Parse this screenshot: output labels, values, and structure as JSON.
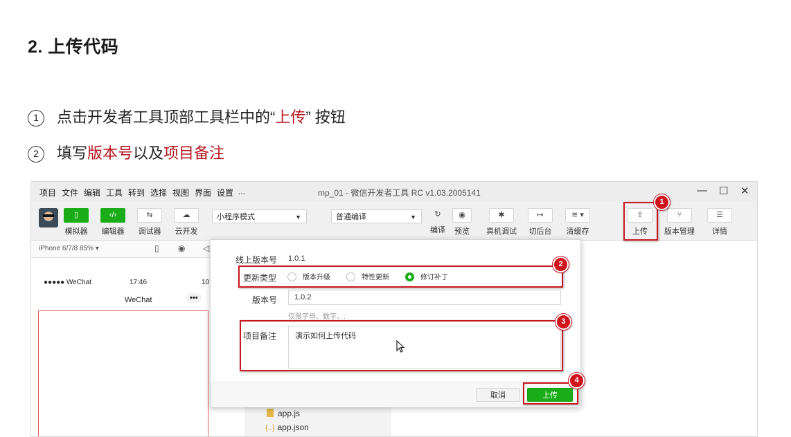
{
  "doc": {
    "heading": "2. 上传代码",
    "steps": [
      {
        "num": "1",
        "pre": "点击开发者工具顶部工具栏中的“",
        "hl": "上传",
        "post": "” 按钮"
      },
      {
        "num": "2",
        "pre": "填写",
        "hl1": "版本号",
        "mid": "以及",
        "hl2": "项目备注"
      }
    ]
  },
  "window": {
    "menu": [
      "项目",
      "文件",
      "编辑",
      "工具",
      "转到",
      "选择",
      "视图",
      "界面",
      "设置",
      "..."
    ],
    "title": "mp_01 - 微信开发者工具 RC v1.03.2005141",
    "controls": {
      "min": "—",
      "max": "☐",
      "close": "✕"
    }
  },
  "toolbar": {
    "simulator": "模拟器",
    "editor": "编辑器",
    "debugger": "调试器",
    "cloud": "云开发",
    "mode_select": "小程序模式",
    "compile_select": "普通编译",
    "compile": "编译",
    "preview": "预览",
    "remote_debug": "真机调试",
    "background": "切后台",
    "clear_cache": "清缓存",
    "upload": "上传",
    "version_mgmt": "版本管理",
    "details": "详情",
    "icons": {
      "simulator": "phone-icon",
      "editor": "code-icon",
      "debugger": "arrows-icon",
      "cloud": "cloud-icon",
      "compile": "refresh-icon",
      "preview": "eye-icon",
      "remote_debug": "bug-icon",
      "background": "switch-icon",
      "clear_cache": "layers-icon",
      "upload": "upload-icon",
      "version_mgmt": "branch-icon",
      "details": "menu-icon"
    }
  },
  "simulator": {
    "device": "iPhone 6/7/8 85% ▾",
    "carrier": "●●●●● WeChat",
    "time": "17:46",
    "battery": "10",
    "nav_title": "WeChat",
    "menu_dots": "•••"
  },
  "files": [
    "app.js",
    "app.json"
  ],
  "dialog": {
    "online_version_label": "线上版本号",
    "online_version": "1.0.1",
    "update_type_label": "更新类型",
    "options": [
      "版本升级",
      "特性更新",
      "修订补丁"
    ],
    "selected_option": 2,
    "version_label": "版本号",
    "version_value": "1.0.2",
    "version_hint": "仅限字母、数字、.",
    "remark_label": "项目备注",
    "remark_value": "演示如何上传代码",
    "cancel": "取消",
    "submit": "上传"
  },
  "annotations": [
    "1",
    "2",
    "3",
    "4"
  ],
  "colors": {
    "accent_red": "#c8161e",
    "wechat_green": "#1aad19",
    "text_red": "#b3141c"
  }
}
